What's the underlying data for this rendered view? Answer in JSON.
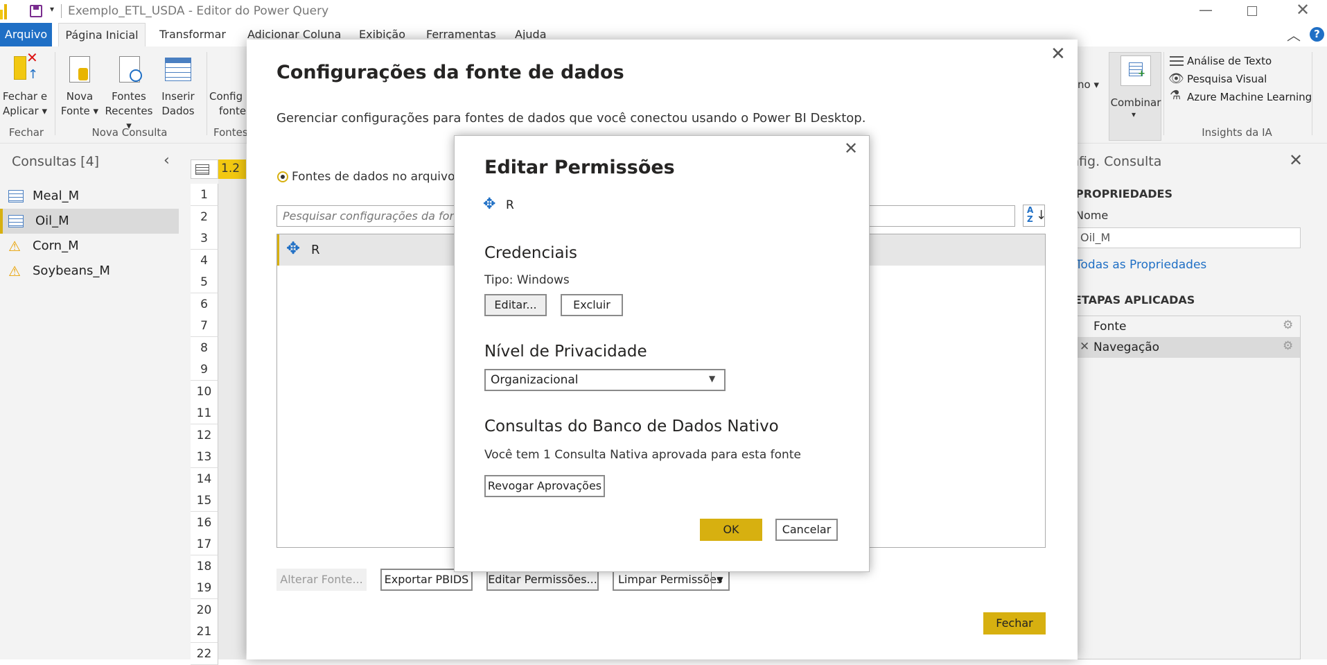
{
  "window": {
    "title": "Exemplo_ETL_USDA - Editor do Power Query"
  },
  "tabs": [
    "Arquivo",
    "Página Inicial",
    "Transformar",
    "Adicionar Coluna",
    "Exibição",
    "Ferramentas",
    "Ajuda"
  ],
  "ribbon": {
    "close_apply": "Fechar e Aplicar",
    "close_apply_l1": "Fechar e",
    "close_apply_l2": "Aplicar",
    "new_source_l1": "Nova",
    "new_source_l2": "Fonte",
    "recent_sources_l1": "Fontes",
    "recent_sources_l2": "Recentes",
    "insert_data_l1": "Inserir",
    "insert_data_l2": "Dados",
    "config_l1": "Config",
    "config_l2": "fonte",
    "group_close": "Fechar",
    "group_new_query": "Nova Consulta",
    "group_sources": "Fontes",
    "combine": "Combinar",
    "partial_label": "no",
    "text_analysis": "Análise de Texto",
    "visual_search": "Pesquisa Visual",
    "azure_ml": "Azure Machine Learning",
    "group_ai": "Insights da IA"
  },
  "queries": {
    "header": "Consultas [4]",
    "items": [
      {
        "name": "Meal_M",
        "icon": "table-icon"
      },
      {
        "name": "Oil_M",
        "icon": "table-icon",
        "selected": true
      },
      {
        "name": "Corn_M",
        "icon": "warning-icon"
      },
      {
        "name": "Soybeans_M",
        "icon": "warning-icon"
      }
    ]
  },
  "grid": {
    "col_type": "1.2",
    "rows": [
      "1",
      "2",
      "3",
      "4",
      "5",
      "6",
      "7",
      "8",
      "9",
      "10",
      "11",
      "12",
      "13",
      "14",
      "15",
      "16",
      "17",
      "18",
      "19",
      "20",
      "21",
      "22"
    ]
  },
  "query_settings": {
    "title": "nfig. Consulta",
    "properties": "PROPRIEDADES",
    "name_label": "Nome",
    "name_value": "Oil_M",
    "all_properties": "Todas as Propriedades",
    "applied_steps": "ETAPAS APLICADAS",
    "steps": [
      "Fonte",
      "Navegação"
    ]
  },
  "data_source_dialog": {
    "title": "Configurações da fonte de dados",
    "description": "Gerenciar configurações para fontes de dados que você conectou usando o Power BI Desktop.",
    "radio_label": "Fontes de dados no arquivo a",
    "search_placeholder": "Pesquisar configurações da font",
    "source_name": "R",
    "btn_change": "Alterar Fonte...",
    "btn_export": "Exportar PBIDS",
    "btn_edit_perm": "Editar Permissões...",
    "btn_clear_perm": "Limpar Permissões",
    "btn_close": "Fechar"
  },
  "edit_permissions_dialog": {
    "title": "Editar Permissões",
    "source": "R",
    "credentials_heading": "Credenciais",
    "type_text": "Tipo: Windows",
    "btn_edit": "Editar...",
    "btn_delete": "Excluir",
    "privacy_heading": "Nível de Privacidade",
    "privacy_value": "Organizacional",
    "native_heading": "Consultas do Banco de Dados Nativo",
    "native_text": "Você tem 1 Consulta Nativa aprovada para esta fonte",
    "btn_revoke": "Revogar Aprovações",
    "btn_ok": "OK",
    "btn_cancel": "Cancelar"
  }
}
